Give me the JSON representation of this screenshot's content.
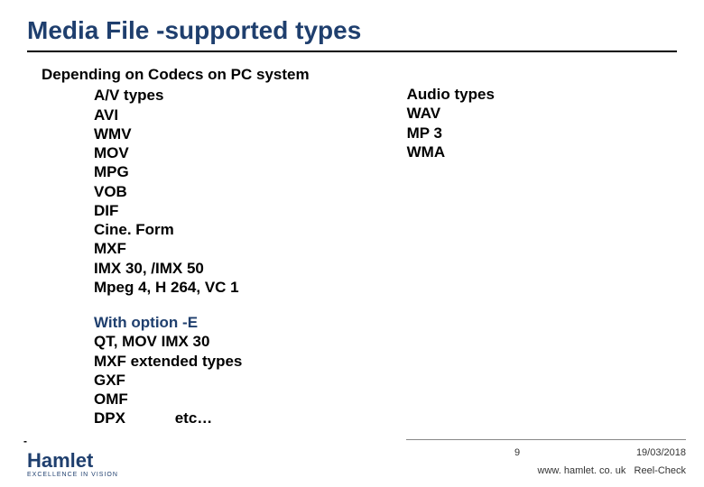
{
  "title": "Media File -supported types",
  "intro": "Depending on Codecs on PC system",
  "left": {
    "heading": "A/V types",
    "items": [
      "AVI",
      "WMV",
      "MOV",
      "MPG",
      "VOB",
      "DIF",
      "Cine. Form",
      "MXF",
      "IMX 30, /IMX 50",
      "Mpeg 4, H 264,  VC 1"
    ]
  },
  "right": {
    "heading": "Audio types",
    "items": [
      "WAV",
      "MP 3",
      "WMA"
    ]
  },
  "option": {
    "heading": "With option -E",
    "items": [
      "QT, MOV  IMX 30",
      "MXF extended types",
      "GXF",
      "OMF"
    ],
    "last": "DPX",
    "etc": "etc…"
  },
  "footer": {
    "slide_number": "9",
    "date": "19/03/2018",
    "site": "www. hamlet. co. uk",
    "product": "Reel-Check"
  },
  "logo": {
    "brand": "Hamlet",
    "tagline": "EXCELLENCE IN VISION"
  }
}
